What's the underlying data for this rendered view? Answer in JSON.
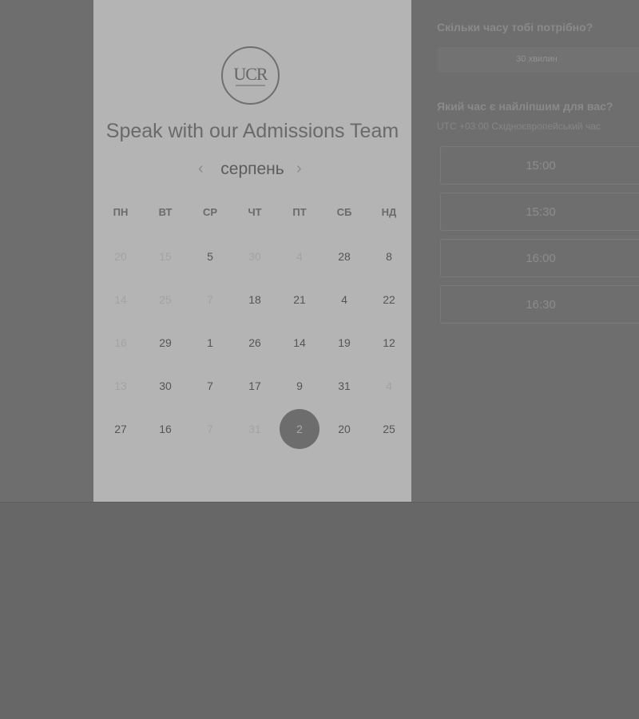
{
  "card": {
    "logo_text": "UCR",
    "title": "Speak with our Admissions Team",
    "month": "серпень",
    "prev_icon": "‹",
    "next_icon": "›"
  },
  "weekdays": [
    "ПН",
    "ВТ",
    "СР",
    "ЧТ",
    "ПТ",
    "СБ",
    "НД"
  ],
  "weeks": [
    [
      {
        "d": "20",
        "muted": true
      },
      {
        "d": "15",
        "muted": true
      },
      {
        "d": "5"
      },
      {
        "d": "30",
        "muted": true
      },
      {
        "d": "4",
        "muted": true
      },
      {
        "d": "28"
      },
      {
        "d": "8"
      }
    ],
    [
      {
        "d": "14",
        "muted": true
      },
      {
        "d": "25",
        "muted": true
      },
      {
        "d": "7",
        "muted": true
      },
      {
        "d": "18"
      },
      {
        "d": "21"
      },
      {
        "d": "4"
      },
      {
        "d": "22"
      }
    ],
    [
      {
        "d": "16",
        "muted": true
      },
      {
        "d": "29"
      },
      {
        "d": "1"
      },
      {
        "d": "26"
      },
      {
        "d": "14"
      },
      {
        "d": "19"
      },
      {
        "d": "12"
      }
    ],
    [
      {
        "d": "13",
        "muted": true
      },
      {
        "d": "30"
      },
      {
        "d": "7"
      },
      {
        "d": "17"
      },
      {
        "d": "9"
      },
      {
        "d": "31"
      },
      {
        "d": "4",
        "muted": true
      }
    ],
    [
      {
        "d": "27"
      },
      {
        "d": "16"
      },
      {
        "d": "7",
        "muted": true
      },
      {
        "d": "31",
        "muted": true
      },
      {
        "d": "2",
        "selected": true
      },
      {
        "d": "20"
      },
      {
        "d": "25"
      }
    ]
  ],
  "right": {
    "duration_question": "Скільки часу тобі потрібно?",
    "duration_value": "30 хвилин",
    "time_question": "Який час є найліпшим для вас?",
    "timezone": "UTC +03:00 Східноєвропейський час",
    "slots": [
      "15:00",
      "15:30",
      "16:00",
      "16:30"
    ]
  },
  "colors": {
    "background": "#676767",
    "card": "#b4b4b4",
    "selected_day": "#6d6d6d"
  }
}
